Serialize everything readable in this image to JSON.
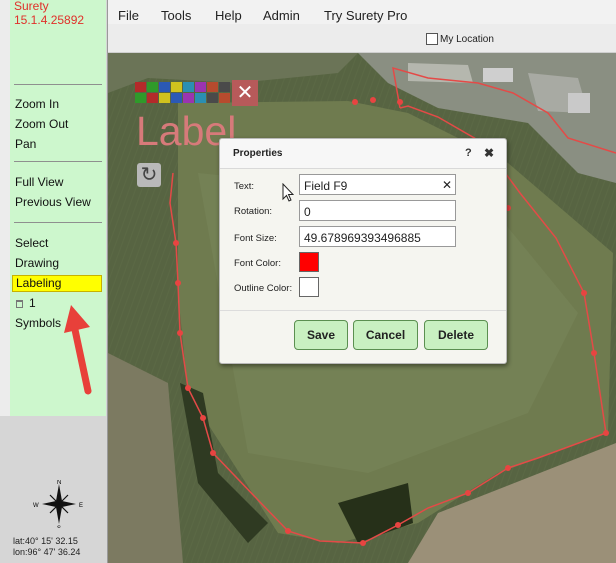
{
  "app": {
    "name": "Surety",
    "version": "15.1.4.25892"
  },
  "menu": [
    "File",
    "Tools",
    "Help",
    "Admin",
    "Try Surety Pro"
  ],
  "toolbar": {
    "my_location_label": "My Location"
  },
  "sidebar": {
    "zoom_in": "Zoom In",
    "zoom_out": "Zoom Out",
    "pan": "Pan",
    "full_view": "Full View",
    "previous_view": "Previous View",
    "select": "Select",
    "drawing": "Drawing",
    "labeling": "Labeling",
    "layer_count": "1",
    "symbols": "Symbols",
    "compass": {
      "n": "N",
      "s": "S",
      "e": "E",
      "w": "W"
    },
    "lat": "lat:40° 15' 32.15",
    "lon": "lon:96° 47' 36.24"
  },
  "map": {
    "label_text": "Label",
    "close_glyph": "✕",
    "refresh_glyph": "↻",
    "palette_colors": [
      [
        "#b42a2a",
        "#2f9a2a",
        "#2b59b5",
        "#d1c21e",
        "#2b8fb2",
        "#9b34b0",
        "#b74b2e",
        "#4a4a4a"
      ],
      [
        "#2f9a2a",
        "#b42a2a",
        "#d1c21e",
        "#2b59b5",
        "#9b34b0",
        "#2b8fb2",
        "#4a4a4a",
        "#b74b2e"
      ]
    ]
  },
  "dialog": {
    "title": "Properties",
    "help": "?",
    "close": "✖",
    "text_label": "Text:",
    "text_value": "Field F9",
    "clear_glyph": "✕",
    "rotation_label": "Rotation:",
    "rotation_value": "0",
    "font_size_label": "Font Size:",
    "font_size_value": "49.678969393496885",
    "font_color_label": "Font Color:",
    "font_color": "#ff0000",
    "outline_color_label": "Outline Color:",
    "outline_color": "#ffffff",
    "save": "Save",
    "cancel": "Cancel",
    "delete": "Delete"
  }
}
